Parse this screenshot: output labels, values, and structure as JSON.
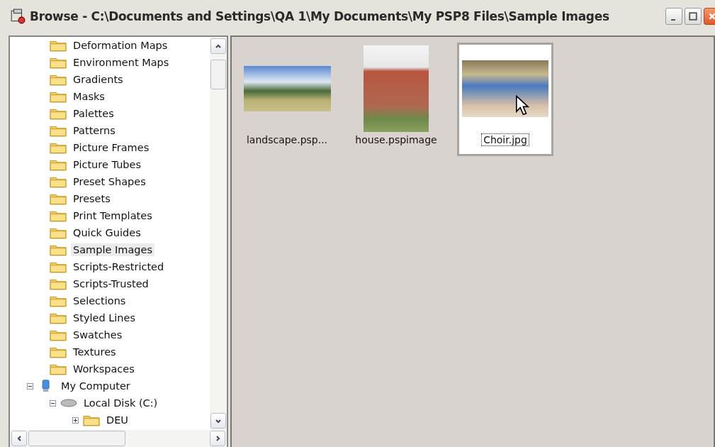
{
  "window": {
    "title": "Browse - C:\\Documents and Settings\\QA 1\\My Documents\\My PSP8 Files\\Sample Images"
  },
  "tree": [
    {
      "kind": "continued",
      "children": [
        {
          "label": "Deformation Maps",
          "kind": "folder",
          "selected": false
        },
        {
          "label": "Environment Maps",
          "kind": "folder",
          "selected": false
        },
        {
          "label": "Gradients",
          "kind": "folder",
          "selected": false
        },
        {
          "label": "Masks",
          "kind": "folder",
          "selected": false
        },
        {
          "label": "Palettes",
          "kind": "folder",
          "selected": false
        },
        {
          "label": "Patterns",
          "kind": "folder",
          "selected": false
        },
        {
          "label": "Picture Frames",
          "kind": "folder",
          "selected": false
        },
        {
          "label": "Picture Tubes",
          "kind": "folder",
          "selected": false
        },
        {
          "label": "Preset Shapes",
          "kind": "folder",
          "selected": false
        },
        {
          "label": "Presets",
          "kind": "folder",
          "selected": false
        },
        {
          "label": "Print Templates",
          "kind": "folder",
          "selected": false
        },
        {
          "label": "Quick Guides",
          "kind": "folder",
          "selected": false
        },
        {
          "label": "Sample Images",
          "kind": "folder",
          "selected": true
        },
        {
          "label": "Scripts-Restricted",
          "kind": "folder",
          "selected": false
        },
        {
          "label": "Scripts-Trusted",
          "kind": "folder",
          "selected": false
        },
        {
          "label": "Selections",
          "kind": "folder",
          "selected": false
        },
        {
          "label": "Styled Lines",
          "kind": "folder",
          "selected": false
        },
        {
          "label": "Swatches",
          "kind": "folder",
          "selected": false
        },
        {
          "label": "Textures",
          "kind": "folder",
          "selected": false
        },
        {
          "label": "Workspaces",
          "kind": "folder",
          "selected": false
        }
      ]
    },
    {
      "label": "My Computer",
      "kind": "computer",
      "selected": false,
      "expanded": true,
      "children": [
        {
          "label": "Local Disk (C:)",
          "kind": "disk",
          "selected": false,
          "expanded": true,
          "children": [
            {
              "label": "DEU",
              "kind": "folder",
              "selected": false,
              "expanded": false
            }
          ]
        }
      ]
    }
  ],
  "files": [
    {
      "name": "landscape.psp...",
      "kind": "landscape",
      "selected": false
    },
    {
      "name": "house.pspimage",
      "kind": "portrait",
      "selected": false
    },
    {
      "name": "Choir.jpg",
      "kind": "landscape",
      "selected": true
    }
  ]
}
